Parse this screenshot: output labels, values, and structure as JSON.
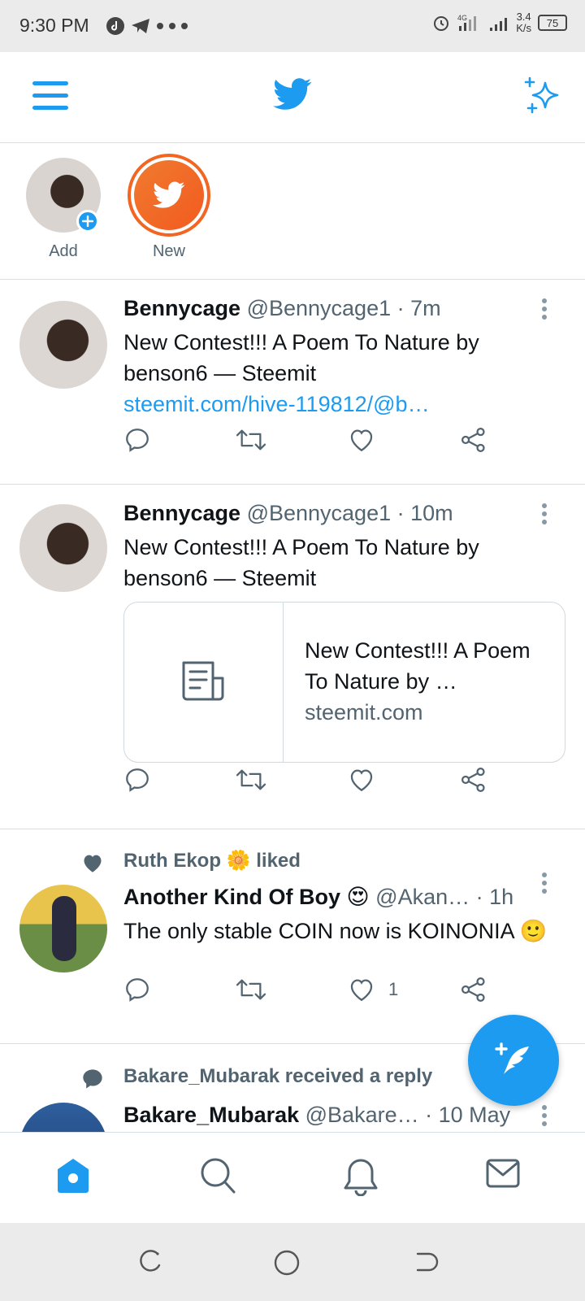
{
  "status_bar": {
    "time": "9:30 PM",
    "network": "4G",
    "speed_value": "3.4",
    "speed_unit": "K/s",
    "battery": "75"
  },
  "fleets": [
    {
      "label": "Add"
    },
    {
      "label": "New"
    }
  ],
  "tweets": [
    {
      "name": "Bennycage",
      "handle": "@Bennycage1",
      "time": "· 7m",
      "text": "New Contest!!! A Poem To Nature by benson6 — Steemit",
      "link": "steemit.com/hive-119812/@b…"
    },
    {
      "name": "Bennycage",
      "handle": "@Bennycage1",
      "time": "· 10m",
      "text": "New Contest!!! A Poem To Nature by benson6 — Steemit",
      "card_title": "New Contest!!! A Poem To Nature by …",
      "card_domain": "steemit.com"
    },
    {
      "social_context": "Ruth Ekop",
      "social_suffix": "liked",
      "name": "Another Kind Of Boy 😍",
      "handle": "@Akan…",
      "time": "· 1h",
      "text": "The only stable COIN now is KOINONIA 🙂",
      "like_count": "1"
    },
    {
      "social_context": "Bakare_Mubarak received a reply",
      "name": "Bakare_Mubarak",
      "handle": "@Bakare…",
      "time": "· 10 May"
    }
  ],
  "colors": {
    "brand": "#1d9bf0",
    "fleet_orange": "#f26522",
    "text_secondary": "#536471"
  }
}
